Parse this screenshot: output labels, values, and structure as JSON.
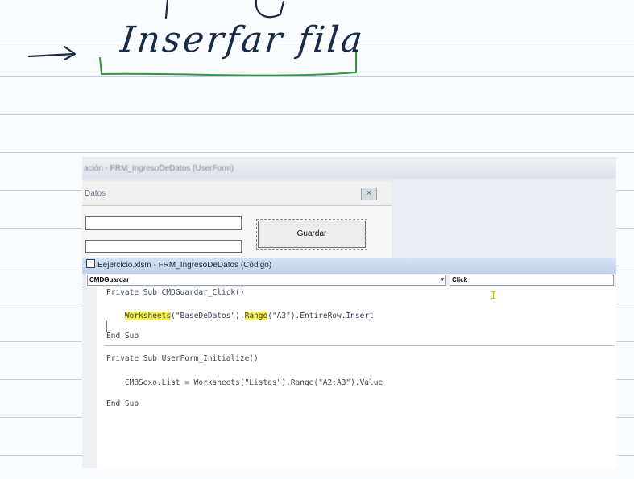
{
  "notes": {
    "arrow_symbol": "⟶",
    "handwritten_text": "Inserfar fila"
  },
  "background_window": {
    "title": "ación - FRM_IngresoDeDatos (UserForm)",
    "form_caption": "Datos",
    "close_symbol": "✕",
    "guardar_button_label": "Guardar"
  },
  "code_window": {
    "title": "Eejercicio.xlsm - FRM_IngresoDeDatos (Código)",
    "object_selector": "CMDGuardar",
    "procedure_selector": "Click",
    "dropdown_arrow": "▾",
    "lines": {
      "sub1_header": "Private Sub CMDGuardar_Click()",
      "sub1_indent": "    ",
      "sub1_word1": "Worksheets",
      "sub1_mid": "(\"BaseDeDatos\").",
      "sub1_word2": "Rango",
      "sub1_tail": "(\"A3\").EntireRow.Insert",
      "sub1_end": "End Sub",
      "sub2_header": "Private Sub UserForm_Initialize()",
      "sub2_body": "    CMBSexo.List = Worksheets(\"Listas\").Range(\"A2:A3\").Value",
      "sub2_end": "End Sub"
    },
    "text_cursor_symbol": "I"
  },
  "colors": {
    "highlight": "#f4f24a",
    "green_pen": "#2e9a3a",
    "blue_pen": "#1a2b47",
    "titlebar": "#c1d3ea"
  }
}
